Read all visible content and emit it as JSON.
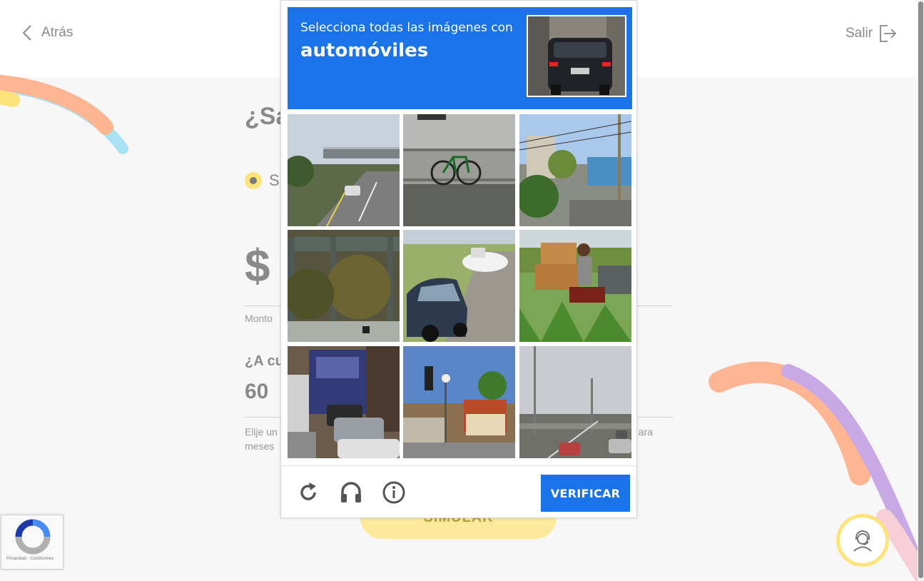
{
  "header": {
    "back_label": "Atrás",
    "logout_label": "Salir"
  },
  "form": {
    "question1_partial": "¿Sa",
    "radio_partial": "Si",
    "currency_symbol": "$",
    "amount_label_partial": "Monto",
    "question2_partial": "¿A cu",
    "months_value": "60",
    "hint_line1_partial": "Elije un",
    "hint_line2_partial": "meses",
    "hint_right_partial": "ara",
    "simulate_button_partial": "SIMULAR"
  },
  "captcha": {
    "instruction": "Selecciona todas las imágenes con",
    "target": "automóviles",
    "verify_label": "VERIFICAR",
    "tiles": [
      {
        "scene": "overpass road with car"
      },
      {
        "scene": "bicycle on railing"
      },
      {
        "scene": "street with shops and wires"
      },
      {
        "scene": "bridge with trees"
      },
      {
        "scene": "car towing boat"
      },
      {
        "scene": "motorbike with boxes"
      },
      {
        "scene": "truck in traffic"
      },
      {
        "scene": "traffic light and houses"
      },
      {
        "scene": "highway under cloudy sky"
      }
    ],
    "icons": [
      "reload-icon",
      "headphones-icon",
      "info-icon"
    ]
  },
  "badge": {
    "text": "Privacidad - Condiciones"
  },
  "colors": {
    "captcha_blue": "#1a73e8",
    "brand_yellow": "#fde47a",
    "deco_orange": "#fdb592",
    "deco_blue": "#a8e2f4",
    "deco_purple": "#c9a8e6",
    "deco_pink": "#f7cfd8"
  }
}
